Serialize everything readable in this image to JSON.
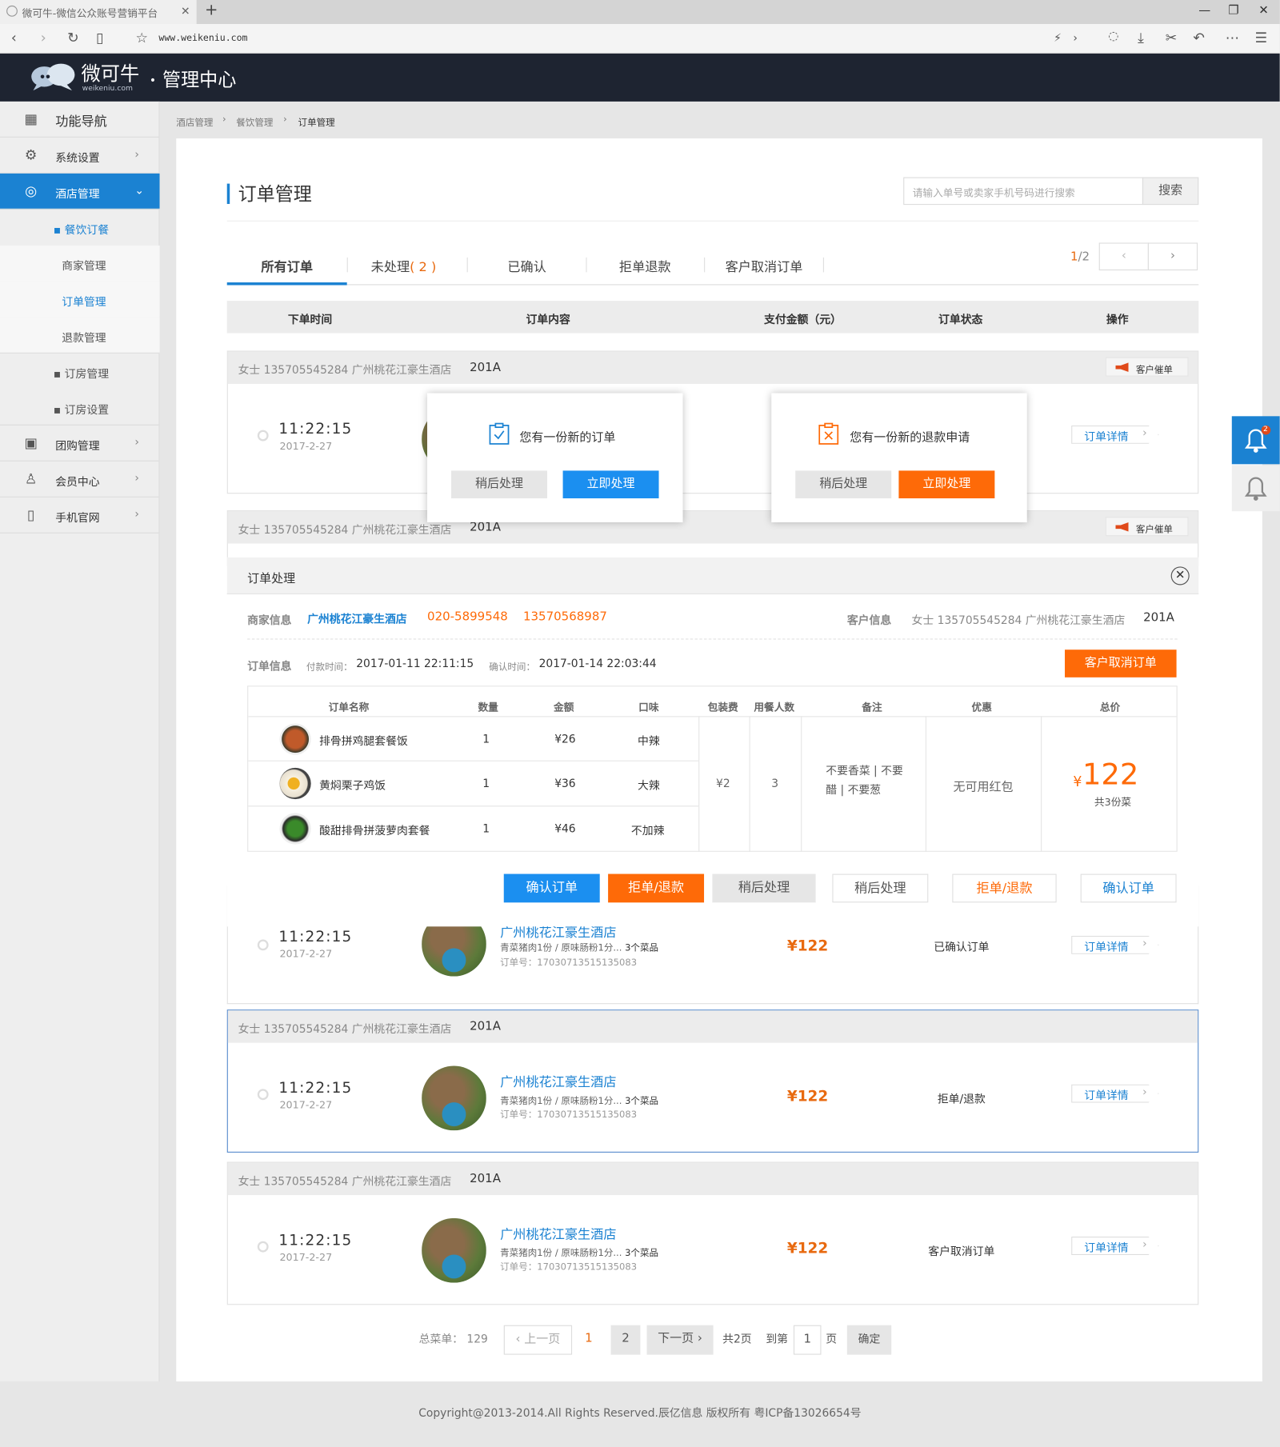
{
  "browser": {
    "tab_title": "微可牛-微信公众账号营销平台",
    "url": "www.weikeniu.com"
  },
  "header": {
    "brand": "微可牛",
    "brand_sub": "weikeniu.com",
    "center": "管理中心"
  },
  "sidebar": {
    "items": [
      {
        "label": "功能导航"
      },
      {
        "label": "系统设置"
      },
      {
        "label": "酒店管理"
      },
      {
        "label": "餐饮订餐"
      },
      {
        "label": "商家管理"
      },
      {
        "label": "订单管理"
      },
      {
        "label": "退款管理"
      },
      {
        "label": "订房管理"
      },
      {
        "label": "订房设置"
      },
      {
        "label": "团购管理"
      },
      {
        "label": "会员中心"
      },
      {
        "label": "手机官网"
      }
    ]
  },
  "breadcrumb": [
    "酒店管理",
    "餐饮管理",
    "订单管理"
  ],
  "page": {
    "title": "订单管理",
    "search_placeholder": "请输入单号或卖家手机号码进行搜索",
    "search_btn": "搜索"
  },
  "tabs": {
    "all": "所有订单",
    "pending": "未处理",
    "pending_count": "( 2 )",
    "confirmed": "已确认",
    "refund": "拒单退款",
    "cancel": "客户取消订单"
  },
  "pager_top": {
    "current": "1",
    "total": "/2"
  },
  "table_head": [
    "下单时间",
    "订单内容",
    "支付金额（元）",
    "订单状态",
    "操作"
  ],
  "orders": [
    {
      "customer": "女士  135705545284   广州桃花江豪生酒店",
      "room": "201A",
      "urge": "客户催单",
      "time": "11:22:15",
      "date": "2017-2-27",
      "detail": "订单详情"
    },
    {
      "customer": "女士  135705545284   广州桃花江豪生酒店",
      "room": "201A",
      "urge": "客户催单"
    },
    {
      "time": "11:22:15",
      "date": "2017-2-27",
      "hotel": "广州桃花江豪生酒店",
      "desc": "青菜猪肉1份 / 原味肠粉1分...",
      "count": "3个菜品",
      "order_no": "订单号：17030713515135083",
      "price": "¥122",
      "status": "已确认订单",
      "detail": "订单详情"
    },
    {
      "customer": "女士  135705545284   广州桃花江豪生酒店",
      "room": "201A",
      "time": "11:22:15",
      "date": "2017-2-27",
      "hotel": "广州桃花江豪生酒店",
      "desc": "青菜猪肉1份 / 原味肠粉1分...",
      "count": "3个菜品",
      "order_no": "订单号：17030713515135083",
      "price": "¥122",
      "status": "拒单/退款",
      "detail": "订单详情"
    },
    {
      "customer": "女士  135705545284   广州桃花江豪生酒店",
      "room": "201A",
      "time": "11:22:15",
      "date": "2017-2-27",
      "hotel": "广州桃花江豪生酒店",
      "desc": "青菜猪肉1份 / 原味肠粉1分...",
      "count": "3个菜品",
      "order_no": "订单号：17030713515135083",
      "price": "¥122",
      "status": "客户取消订单",
      "detail": "订单详情"
    }
  ],
  "pagination": {
    "total": "总菜单：  129",
    "prev": "上一页",
    "p1": "1",
    "p2": "2",
    "next": "下一页",
    "pages": "共2页",
    "goto": "到第",
    "page_val": "1",
    "page_unit": "页",
    "ok": "确定"
  },
  "footer": "Copyright@2013-2014.All Rights Reserved.辰亿信息 版权所有 粤ICP备13026654号",
  "notice_order": {
    "text": "您有一份新的订单",
    "later": "稍后处理",
    "now": "立即处理"
  },
  "notice_refund": {
    "text": "您有一份新的退款申请",
    "later": "稍后处理",
    "now": "立即处理"
  },
  "modal": {
    "title": "订单处理",
    "merchant_label": "商家信息",
    "merchant_name": "广州桃花江豪生酒店",
    "merchant_phone": "020-5899548",
    "merchant_mobile": "13570568987",
    "customer_label": "客户信息",
    "customer": "女士  135705545284   广州桃花江豪生酒店",
    "customer_room": "201A",
    "order_label": "订单信息",
    "pay_label": "付款时间：",
    "pay_time": "2017-01-11 22:11:15",
    "confirm_label": "确认时间：",
    "confirm_time": "2017-01-14 22:03:44",
    "cancel_btn": "客户取消订单",
    "cols": [
      "订单名称",
      "数量",
      "金额",
      "口味",
      "包装费",
      "用餐人数",
      "备注",
      "优惠",
      "总价"
    ],
    "dishes": [
      {
        "name": "排骨拼鸡腿套餐饭",
        "qty": "1",
        "amount": "¥26",
        "taste": "中辣"
      },
      {
        "name": "黄焖栗子鸡饭",
        "qty": "1",
        "amount": "¥36",
        "taste": "大辣"
      },
      {
        "name": "酸甜排骨拼菠萝肉套餐",
        "qty": "1",
        "amount": "¥46",
        "taste": "不加辣"
      }
    ],
    "packing": "¥2",
    "diners": "3",
    "remark": "不要香菜 | 不要醋 | 不要葱",
    "discount": "无可用红包",
    "total_sym": "¥",
    "total": "122",
    "total_sub": "共3份菜",
    "buttons": [
      "确认订单",
      "拒单/退款",
      "稍后处理",
      "稍后处理",
      "拒单/退款",
      "确认订单"
    ]
  },
  "colors": {
    "accent": "#1b82d2",
    "orange": "#fe6a08",
    "header": "#1e2431"
  }
}
